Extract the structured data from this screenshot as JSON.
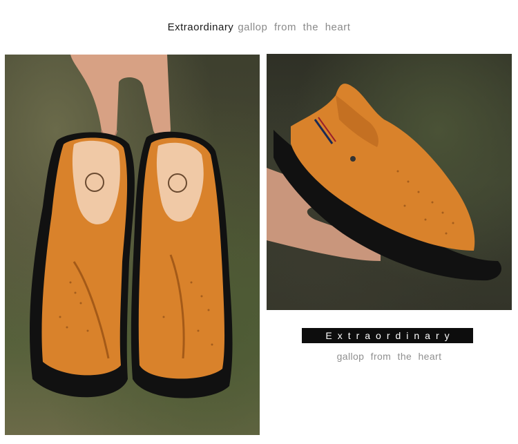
{
  "header": {
    "strong_text": "Extraordinary",
    "soft_text": "gallop from the heart"
  },
  "badge": {
    "text": "Extraordinary"
  },
  "caption": {
    "text": "gallop from the heart"
  },
  "colors": {
    "leather": "#d9822b",
    "sole": "#111111",
    "background": "#ffffff"
  },
  "images": {
    "left": "product-photo-pair-held",
    "right": "product-photo-side-view"
  }
}
